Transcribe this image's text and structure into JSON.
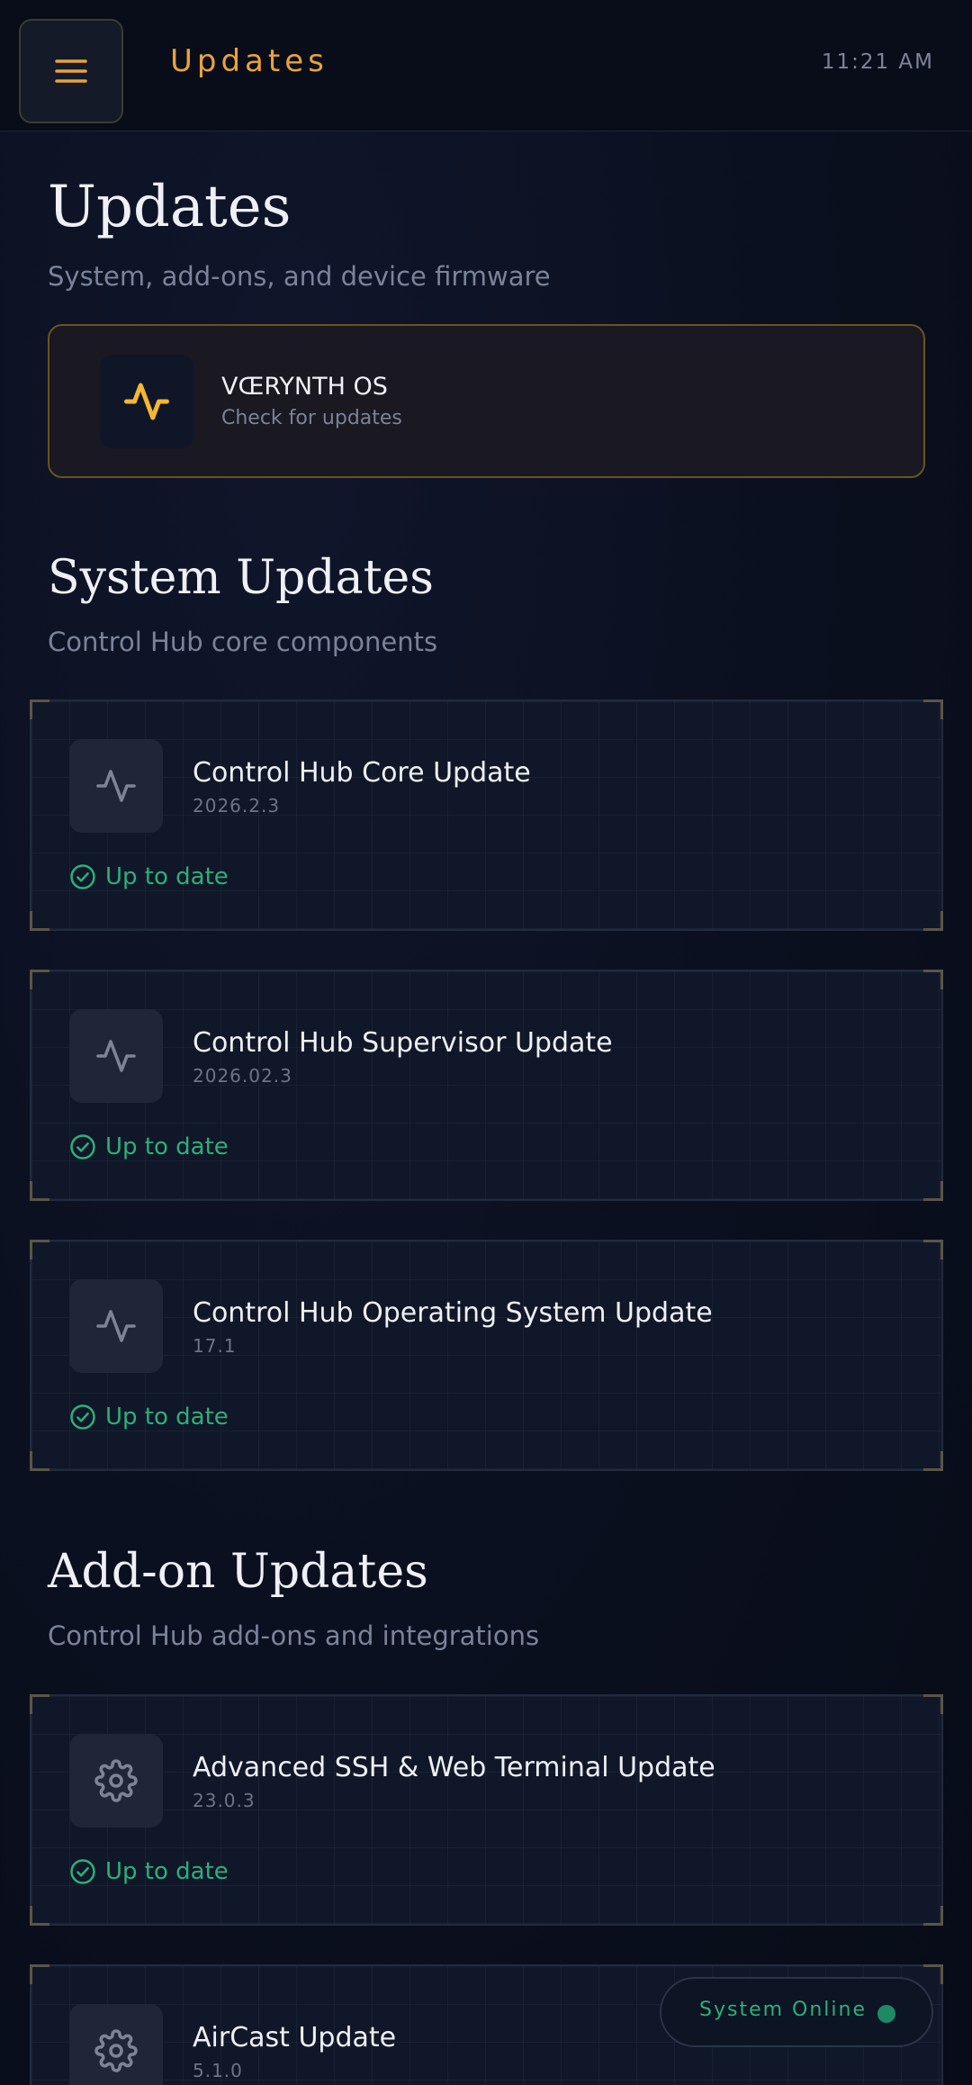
{
  "header": {
    "title": "Updates",
    "time": "11:21 AM",
    "menu_icon": "hamburger-icon"
  },
  "page": {
    "title": "Updates",
    "subtitle": "System, add-ons, and device firmware"
  },
  "os_card": {
    "name": "VŒRYNTH OS",
    "subtitle": "Check for updates",
    "icon": "pulse-icon",
    "accent": "#f5b731"
  },
  "system_section": {
    "title": "System Updates",
    "subtitle": "Control Hub core components"
  },
  "system_updates": [
    {
      "title": "Control Hub Core Update",
      "version": "2026.2.3",
      "status": "Up to date",
      "icon": "pulse-icon"
    },
    {
      "title": "Control Hub Supervisor Update",
      "version": "2026.02.3",
      "status": "Up to date",
      "icon": "pulse-icon"
    },
    {
      "title": "Control Hub Operating System Update",
      "version": "17.1",
      "status": "Up to date",
      "icon": "pulse-icon"
    }
  ],
  "addon_section": {
    "title": "Add-on Updates",
    "subtitle": "Control Hub add-ons and integrations"
  },
  "addon_updates": [
    {
      "title": "Advanced SSH & Web Terminal Update",
      "version": "23.0.3",
      "status": "Up to date",
      "icon": "gear-icon"
    },
    {
      "title": "AirCast Update",
      "version": "5.1.0",
      "icon": "gear-icon"
    }
  ],
  "status_pill": {
    "label": "System Online",
    "color": "#2fae7a"
  }
}
